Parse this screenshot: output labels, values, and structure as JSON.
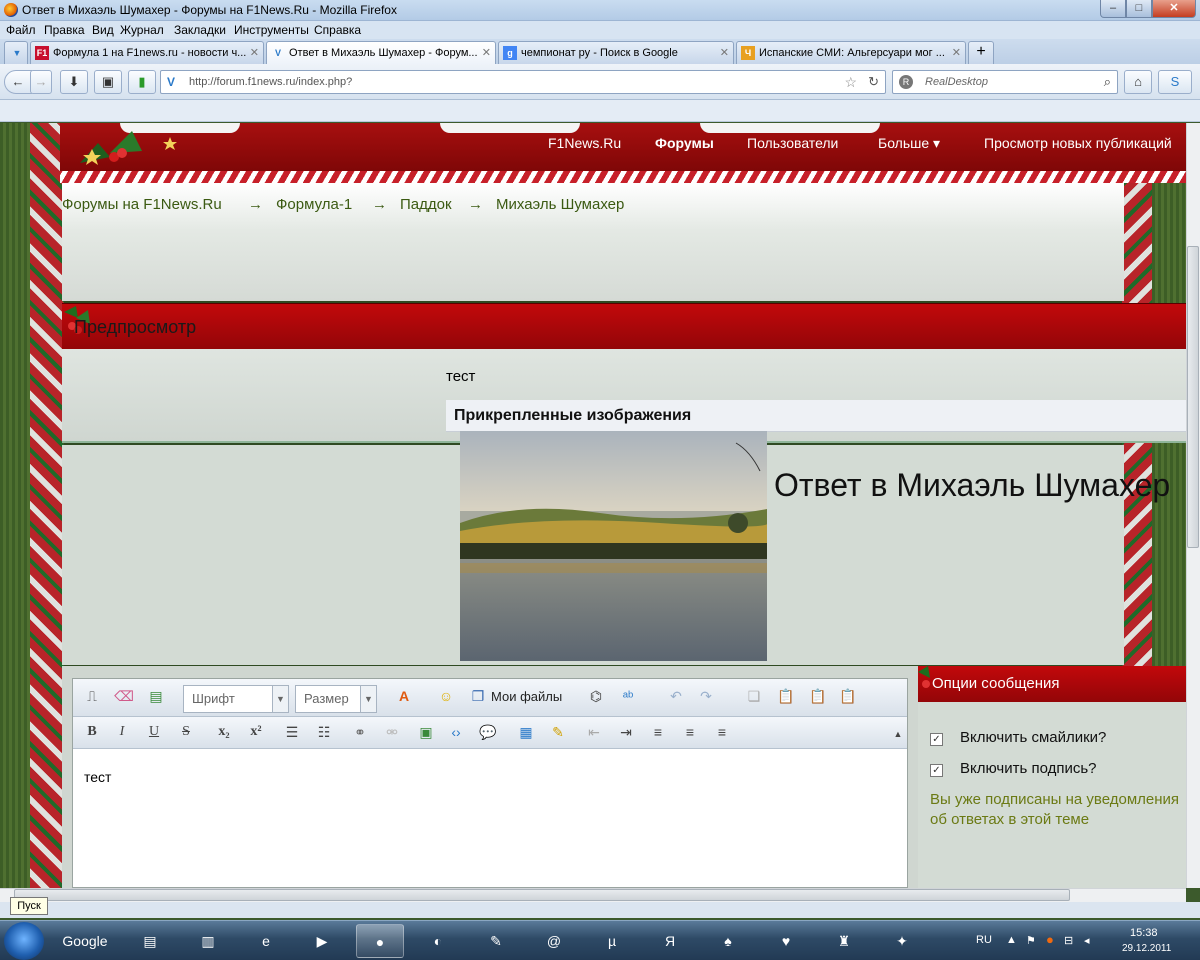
{
  "window": {
    "title": "Ответ в Михаэль Шумахер - Форумы на F1News.Ru - Mozilla Firefox",
    "minimize": "–",
    "maximize": "□",
    "close": "✕"
  },
  "menu": [
    "Файл",
    "Правка",
    "Вид",
    "Журнал",
    "Закладки",
    "Инструменты",
    "Справка"
  ],
  "tabs": [
    {
      "label": "Формула 1 на F1news.ru - новости ч...",
      "icon": "F1"
    },
    {
      "label": "Ответ в Михаэль Шумахер - Форум...",
      "icon": "V",
      "active": true
    },
    {
      "label": "чемпионат ру - Поиск в Google",
      "icon": "g"
    },
    {
      "label": "Испанские СМИ: Альгерсуари мог ...",
      "icon": "Ч"
    }
  ],
  "newtab": "+",
  "nav": {
    "url": "http://forum.f1news.ru/index.php?",
    "search_placeholder": "RealDesktop"
  },
  "site": {
    "nav": [
      "F1News.Ru",
      "Форумы",
      "Пользователи",
      "Больше ▾",
      "Просмотр новых публикаций"
    ],
    "breadcrumb": [
      "Форумы на F1News.Ru",
      "→",
      "Формула-1",
      "→",
      "Паддок",
      "→",
      "Михаэль Шумахер"
    ]
  },
  "preview": {
    "title": "Предпросмотр",
    "message": "тест",
    "attachments_header": "Прикрепленные изображения",
    "big_title": "Ответ в Михаэль Шумахер"
  },
  "editor": {
    "font_label": "Шрифт",
    "size_label": "Размер",
    "my_files": "Мои файлы",
    "content": "тест"
  },
  "options": {
    "title": "Опции сообщения",
    "smilies": "Включить смайлики?",
    "signature": "Включить подпись?",
    "info_line1": "Вы уже подписаны на уведомления",
    "info_line2": "об ответах в этой теме"
  },
  "status": {
    "tooltip": "Пуск"
  },
  "taskbar": {
    "google": "Google",
    "lang": "RU",
    "time": "15:38",
    "date": "29.12.2011"
  }
}
